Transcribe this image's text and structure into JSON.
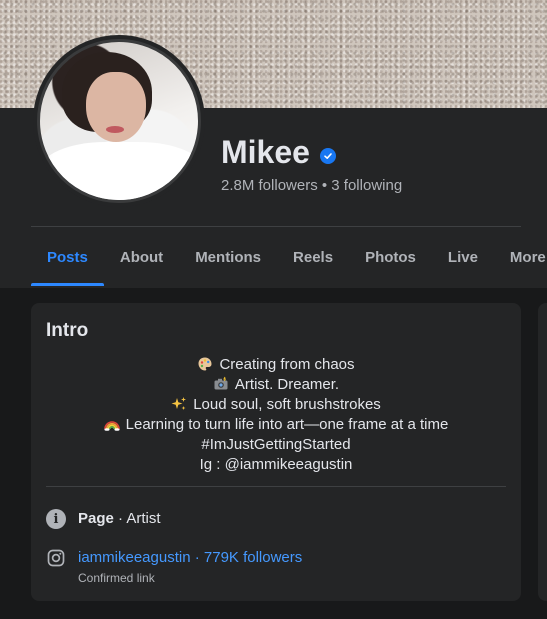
{
  "profile": {
    "name": "Mikee",
    "stats": "2.8M followers • 3 following"
  },
  "tabs": [
    {
      "label": "Posts",
      "active": true
    },
    {
      "label": "About"
    },
    {
      "label": "Mentions"
    },
    {
      "label": "Reels"
    },
    {
      "label": "Photos"
    },
    {
      "label": "Live"
    },
    {
      "label": "More"
    }
  ],
  "intro": {
    "title": "Intro",
    "bio": [
      {
        "icon": "palette-icon",
        "text": "Creating from chaos"
      },
      {
        "icon": "camera-flash-icon",
        "text": "Artist. Dreamer."
      },
      {
        "icon": "sparkles-icon",
        "text": "Loud soul, soft brushstrokes"
      },
      {
        "icon": "rainbow-icon",
        "text": "Learning to turn life into art—one frame at a time"
      },
      {
        "icon": "",
        "text": "#ImJustGettingStarted"
      },
      {
        "icon": "",
        "text": "Ig : @iammikeeagustin"
      }
    ],
    "page_label": "Page",
    "page_category": " · Artist",
    "instagram": {
      "handle_line": "iammikeeagustin · 779K followers",
      "note": "Confirmed link"
    }
  },
  "colors": {
    "accent": "#2d88ff",
    "link": "#4599ff",
    "verified": "#1877f2",
    "background": "#18191a",
    "card": "#242526"
  }
}
